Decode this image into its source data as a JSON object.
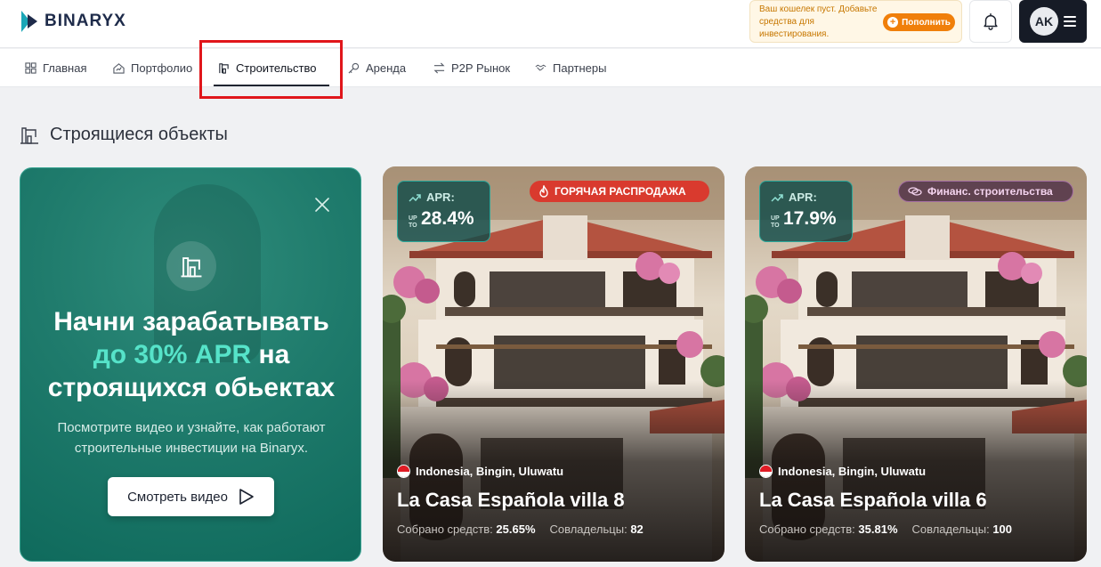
{
  "app": {
    "brand": "BINARYX"
  },
  "wallet": {
    "notice": "Ваш кошелек пуст. Добавьте средства для инвестирования.",
    "topup_label": "Пополнить"
  },
  "user": {
    "initials": "AK"
  },
  "nav": {
    "items": [
      {
        "label": "Главная",
        "icon": "grid-icon"
      },
      {
        "label": "Портфолио",
        "icon": "portfolio-icon"
      },
      {
        "label": "Строительство",
        "icon": "construction-icon",
        "active": true
      },
      {
        "label": "Аренда",
        "icon": "key-icon"
      },
      {
        "label": "P2P Рынок",
        "icon": "swap-icon"
      },
      {
        "label": "Партнеры",
        "icon": "handshake-icon"
      }
    ]
  },
  "section": {
    "title": "Строящиеся объекты"
  },
  "promo": {
    "headline_1": "Начни зарабатывать",
    "headline_highlight": "до 30% APR",
    "headline_2": "на",
    "headline_3": "строящихся обьектах",
    "subtitle": "Посмотрите видео и узнайте, как работают строительные инвестиции на Binaryx.",
    "button_label": "Смотреть видео"
  },
  "cards": [
    {
      "apr_label": "APR:",
      "apr_prefix": "UP TO",
      "apr_value": "28.4%",
      "badge": "ГОРЯЧАЯ РАСПРОДАЖА",
      "location": "Indonesia, Bingin, Uluwatu",
      "title": "La Casa Española villa 8",
      "raised_label": "Собрано средств:",
      "raised_value": "25.65%",
      "owners_label": "Совладельцы:",
      "owners_value": "82"
    },
    {
      "apr_label": "APR:",
      "apr_prefix": "UP TO",
      "apr_value": "17.9%",
      "badge": "Финанс. строительства",
      "location": "Indonesia, Bingin, Uluwatu",
      "title": "La Casa Española villa 6",
      "raised_label": "Собрано средств:",
      "raised_value": "35.81%",
      "owners_label": "Совладельцы:",
      "owners_value": "100"
    }
  ],
  "colors": {
    "accent_teal": "#1f7b6c",
    "highlight_teal": "#56e3c9",
    "hot_red": "#d93a2e",
    "topup_orange": "#f07f0a",
    "annotation_red": "#e0161b"
  }
}
